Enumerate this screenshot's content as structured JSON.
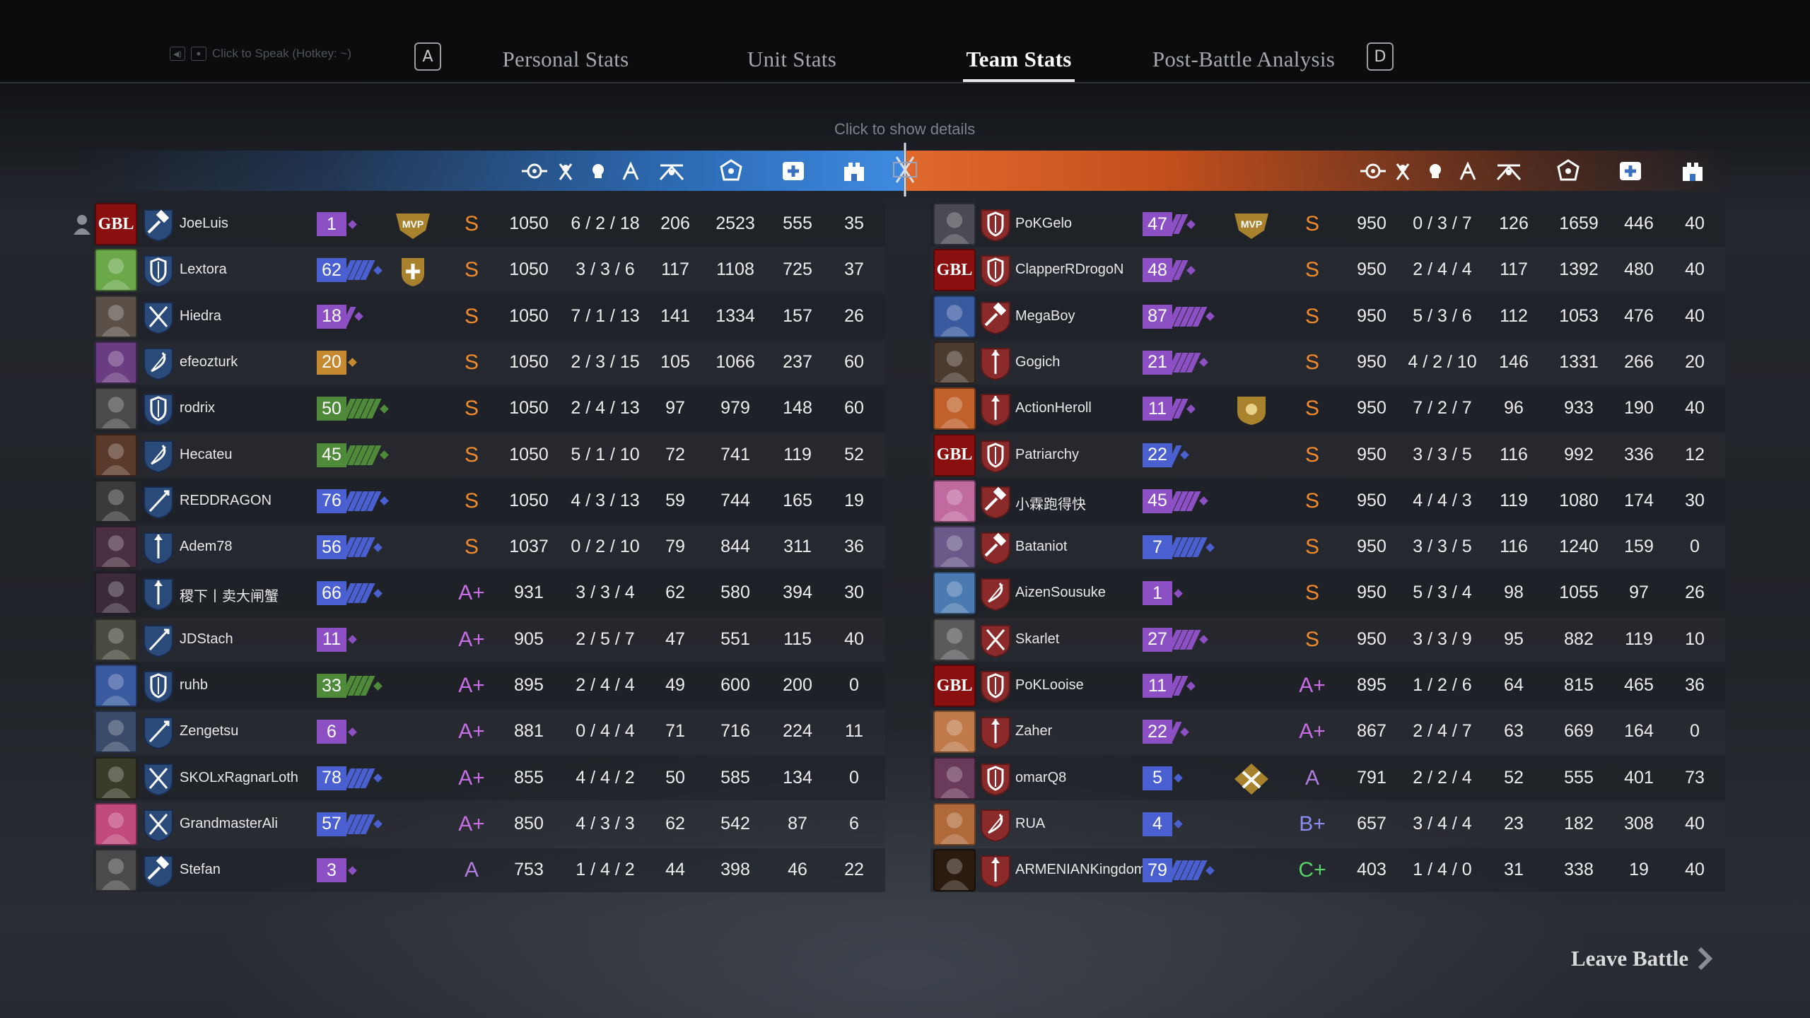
{
  "voice": {
    "label": "Click to Speak (Hotkey: ~)"
  },
  "keys": {
    "left": "A",
    "right": "D"
  },
  "tabs": [
    {
      "label": "Personal Stats",
      "active": false
    },
    {
      "label": "Unit Stats",
      "active": false
    },
    {
      "label": "Team Stats",
      "active": true
    },
    {
      "label": "Post-Battle Analysis",
      "active": false
    }
  ],
  "hint": "Click to show details",
  "columns": [
    "score-icon",
    "kda-icon",
    "kills-icon",
    "damage-icon",
    "healing-icon",
    "siege-icon"
  ],
  "colors": {
    "blue_band": "#3f8ae0",
    "orange_band": "#e0692c",
    "grade_S": "#f08a2c",
    "grade_Aplus": "#c86ee6",
    "grade_A": "#b07ce0",
    "grade_Bplus": "#8a8ef0",
    "grade_Cplus": "#58d36a"
  },
  "left_team": [
    {
      "name": "JoeLuis",
      "level": "1",
      "lvcolor": "#8d4fc4",
      "chev": 0,
      "badge": "mvp",
      "grade": "S",
      "score": "1050",
      "kda": "6 / 2 / 18",
      "c3": "206",
      "c4": "2523",
      "c5": "555",
      "c6": "35",
      "avatar": "GBL",
      "avbg": "#8a1010",
      "cls": "hammer"
    },
    {
      "name": "Lextora",
      "level": "62",
      "lvcolor": "#4a5fd0",
      "chev": 4,
      "badge": "heal",
      "grade": "S",
      "score": "1050",
      "kda": "3 / 3 / 6",
      "c3": "117",
      "c4": "1108",
      "c5": "725",
      "c6": "37",
      "avatar": "",
      "avbg": "#6aa84a",
      "cls": "shield"
    },
    {
      "name": "Hiedra",
      "level": "18",
      "lvcolor": "#8d4fc4",
      "chev": 1,
      "badge": "",
      "grade": "S",
      "score": "1050",
      "kda": "7 / 1 / 13",
      "c3": "141",
      "c4": "1334",
      "c5": "157",
      "c6": "26",
      "avatar": "",
      "avbg": "#5a5048",
      "cls": "swords"
    },
    {
      "name": "efeozturk",
      "level": "20",
      "lvcolor": "#c58a30",
      "chev": 0,
      "badge": "",
      "grade": "S",
      "score": "1050",
      "kda": "2 / 3 / 15",
      "c3": "105",
      "c4": "1066",
      "c5": "237",
      "c6": "60",
      "avatar": "",
      "avbg": "#6a3c80",
      "cls": "bow"
    },
    {
      "name": "rodrix",
      "level": "50",
      "lvcolor": "#4e8a3a",
      "chev": 5,
      "badge": "",
      "grade": "S",
      "score": "1050",
      "kda": "2 / 4 / 13",
      "c3": "97",
      "c4": "979",
      "c5": "148",
      "c6": "60",
      "avatar": "",
      "avbg": "#4a4a4a",
      "cls": "shield"
    },
    {
      "name": "Hecateu",
      "level": "45",
      "lvcolor": "#4e8a3a",
      "chev": 5,
      "badge": "",
      "grade": "S",
      "score": "1050",
      "kda": "5 / 1 / 10",
      "c3": "72",
      "c4": "741",
      "c5": "119",
      "c6": "52",
      "avatar": "",
      "avbg": "#5a3a2a",
      "cls": "bow"
    },
    {
      "name": "REDDRAGON",
      "level": "76",
      "lvcolor": "#4a5fd0",
      "chev": 5,
      "badge": "",
      "grade": "S",
      "score": "1050",
      "kda": "4 / 3 / 13",
      "c3": "59",
      "c4": "744",
      "c5": "165",
      "c6": "19",
      "avatar": "",
      "avbg": "#3a3a3a",
      "cls": "lance"
    },
    {
      "name": "Adem78",
      "level": "56",
      "lvcolor": "#4a5fd0",
      "chev": 4,
      "badge": "",
      "grade": "S",
      "score": "1037",
      "kda": "0 / 2 / 10",
      "c3": "79",
      "c4": "844",
      "c5": "311",
      "c6": "36",
      "avatar": "",
      "avbg": "#4a3040",
      "cls": "spear"
    },
    {
      "name": "稷下丨卖大闸蟹",
      "level": "66",
      "lvcolor": "#4a5fd0",
      "chev": 4,
      "badge": "",
      "grade": "A+",
      "score": "931",
      "kda": "3 / 3 / 4",
      "c3": "62",
      "c4": "580",
      "c5": "394",
      "c6": "30",
      "avatar": "",
      "avbg": "#3a2a3a",
      "cls": "spear"
    },
    {
      "name": "JDStach",
      "level": "11",
      "lvcolor": "#8d4fc4",
      "chev": 0,
      "badge": "",
      "grade": "A+",
      "score": "905",
      "kda": "2 / 5 / 7",
      "c3": "47",
      "c4": "551",
      "c5": "115",
      "c6": "40",
      "avatar": "",
      "avbg": "#4a4a40",
      "cls": "lance"
    },
    {
      "name": "ruhb",
      "level": "33",
      "lvcolor": "#4e8a3a",
      "chev": 4,
      "badge": "",
      "grade": "A+",
      "score": "895",
      "kda": "2 / 4 / 4",
      "c3": "49",
      "c4": "600",
      "c5": "200",
      "c6": "0",
      "avatar": "",
      "avbg": "#3a5aa0",
      "cls": "shield"
    },
    {
      "name": "Zengetsu",
      "level": "6",
      "lvcolor": "#8d4fc4",
      "chev": 0,
      "badge": "",
      "grade": "A+",
      "score": "881",
      "kda": "0 / 4 / 4",
      "c3": "71",
      "c4": "716",
      "c5": "224",
      "c6": "11",
      "avatar": "",
      "avbg": "#3a4a6a",
      "cls": "lance"
    },
    {
      "name": "SKOLxRagnarLoth",
      "level": "78",
      "lvcolor": "#4a5fd0",
      "chev": 4,
      "badge": "",
      "grade": "A+",
      "score": "855",
      "kda": "4 / 4 / 2",
      "c3": "50",
      "c4": "585",
      "c5": "134",
      "c6": "0",
      "avatar": "",
      "avbg": "#3a3a2a",
      "cls": "swords"
    },
    {
      "name": "GrandmasterAli",
      "level": "57",
      "lvcolor": "#4a5fd0",
      "chev": 4,
      "badge": "",
      "grade": "A+",
      "score": "850",
      "kda": "4 / 3 / 3",
      "c3": "62",
      "c4": "542",
      "c5": "87",
      "c6": "6",
      "avatar": "",
      "avbg": "#c04a7a",
      "cls": "swords"
    },
    {
      "name": "Stefan",
      "level": "3",
      "lvcolor": "#8d4fc4",
      "chev": 0,
      "badge": "",
      "grade": "A",
      "score": "753",
      "kda": "1 / 4 / 2",
      "c3": "44",
      "c4": "398",
      "c5": "46",
      "c6": "22",
      "avatar": "",
      "avbg": "#4a4a4a",
      "cls": "hammer"
    }
  ],
  "right_team": [
    {
      "name": "PoKGelo",
      "level": "47",
      "lvcolor": "#8d4fc4",
      "chev": 2,
      "badge": "mvp",
      "grade": "S",
      "score": "950",
      "kda": "0 / 3 / 7",
      "c3": "126",
      "c4": "1659",
      "c5": "446",
      "c6": "40",
      "avatar": "",
      "avbg": "#4a4a52",
      "cls": "rshield"
    },
    {
      "name": "ClapperRDrogoN",
      "level": "48",
      "lvcolor": "#8d4fc4",
      "chev": 2,
      "badge": "",
      "grade": "S",
      "score": "950",
      "kda": "2 / 4 / 4",
      "c3": "117",
      "c4": "1392",
      "c5": "480",
      "c6": "40",
      "avatar": "GBL",
      "avbg": "#8a1010",
      "cls": "rshield"
    },
    {
      "name": "MegaBoy",
      "level": "87",
      "lvcolor": "#8d4fc4",
      "chev": 5,
      "badge": "",
      "grade": "S",
      "score": "950",
      "kda": "5 / 3 / 6",
      "c3": "112",
      "c4": "1053",
      "c5": "476",
      "c6": "40",
      "avatar": "",
      "avbg": "#3a5aa0",
      "cls": "rhammer"
    },
    {
      "name": "Gogich",
      "level": "21",
      "lvcolor": "#8d4fc4",
      "chev": 4,
      "badge": "",
      "grade": "S",
      "score": "950",
      "kda": "4 / 2 / 10",
      "c3": "146",
      "c4": "1331",
      "c5": "266",
      "c6": "20",
      "avatar": "",
      "avbg": "#4a3a30",
      "cls": "rspear"
    },
    {
      "name": "ActionHeroll",
      "level": "11",
      "lvcolor": "#8d4fc4",
      "chev": 2,
      "badge": "shield",
      "grade": "S",
      "score": "950",
      "kda": "7 / 2 / 7",
      "c3": "96",
      "c4": "933",
      "c5": "190",
      "c6": "40",
      "avatar": "",
      "avbg": "#c0602a",
      "cls": "rspear"
    },
    {
      "name": "Patriarchy",
      "level": "22",
      "lvcolor": "#4a5fd0",
      "chev": 1,
      "badge": "",
      "grade": "S",
      "score": "950",
      "kda": "3 / 3 / 5",
      "c3": "116",
      "c4": "992",
      "c5": "336",
      "c6": "12",
      "avatar": "GBL",
      "avbg": "#8a1010",
      "cls": "rshield"
    },
    {
      "name": "小霖跑得快",
      "level": "45",
      "lvcolor": "#8d4fc4",
      "chev": 4,
      "badge": "",
      "grade": "S",
      "score": "950",
      "kda": "4 / 4 / 3",
      "c3": "119",
      "c4": "1080",
      "c5": "174",
      "c6": "30",
      "avatar": "",
      "avbg": "#c06aa0",
      "cls": "rhammer"
    },
    {
      "name": "Bataniot",
      "level": "7",
      "lvcolor": "#4a5fd0",
      "chev": 5,
      "badge": "",
      "grade": "S",
      "score": "950",
      "kda": "3 / 3 / 5",
      "c3": "116",
      "c4": "1240",
      "c5": "159",
      "c6": "0",
      "avatar": "",
      "avbg": "#6a5a8a",
      "cls": "rhammer"
    },
    {
      "name": "AizenSousuke",
      "level": "1",
      "lvcolor": "#8d4fc4",
      "chev": 0,
      "badge": "",
      "grade": "S",
      "score": "950",
      "kda": "5 / 3 / 4",
      "c3": "98",
      "c4": "1055",
      "c5": "97",
      "c6": "26",
      "avatar": "",
      "avbg": "#4a7ab0",
      "cls": "rbow"
    },
    {
      "name": "Skarlet",
      "level": "27",
      "lvcolor": "#8d4fc4",
      "chev": 4,
      "badge": "",
      "grade": "S",
      "score": "950",
      "kda": "3 / 3 / 9",
      "c3": "95",
      "c4": "882",
      "c5": "119",
      "c6": "10",
      "avatar": "",
      "avbg": "#5a5a5a",
      "cls": "rswords"
    },
    {
      "name": "PoKLooise",
      "level": "11",
      "lvcolor": "#8d4fc4",
      "chev": 2,
      "badge": "",
      "grade": "A+",
      "score": "895",
      "kda": "1 / 2 / 6",
      "c3": "64",
      "c4": "815",
      "c5": "465",
      "c6": "36",
      "avatar": "GBL",
      "avbg": "#8a1010",
      "cls": "rshield"
    },
    {
      "name": "Zaher",
      "level": "22",
      "lvcolor": "#8d4fc4",
      "chev": 1,
      "badge": "",
      "grade": "A+",
      "score": "867",
      "kda": "2 / 4 / 7",
      "c3": "63",
      "c4": "669",
      "c5": "164",
      "c6": "0",
      "avatar": "",
      "avbg": "#c07a4a",
      "cls": "rspear"
    },
    {
      "name": "omarQ8",
      "level": "5",
      "lvcolor": "#4a5fd0",
      "chev": 0,
      "badge": "cross",
      "grade": "A",
      "score": "791",
      "kda": "2 / 2 / 4",
      "c3": "52",
      "c4": "555",
      "c5": "401",
      "c6": "73",
      "avatar": "",
      "avbg": "#6a3a5a",
      "cls": "rshield"
    },
    {
      "name": "RUA",
      "level": "4",
      "lvcolor": "#4a5fd0",
      "chev": 0,
      "badge": "",
      "grade": "B+",
      "score": "657",
      "kda": "3 / 4 / 4",
      "c3": "23",
      "c4": "182",
      "c5": "308",
      "c6": "40",
      "avatar": "",
      "avbg": "#b06a3a",
      "cls": "rbow"
    },
    {
      "name": "ARMENIANKingdom",
      "level": "79",
      "lvcolor": "#4a5fd0",
      "chev": 5,
      "badge": "",
      "grade": "C+",
      "score": "403",
      "kda": "1 / 4 / 0",
      "c3": "31",
      "c4": "338",
      "c5": "19",
      "c6": "40",
      "avatar": "",
      "avbg": "#2a1a10",
      "cls": "rspear"
    }
  ],
  "leave": "Leave Battle"
}
